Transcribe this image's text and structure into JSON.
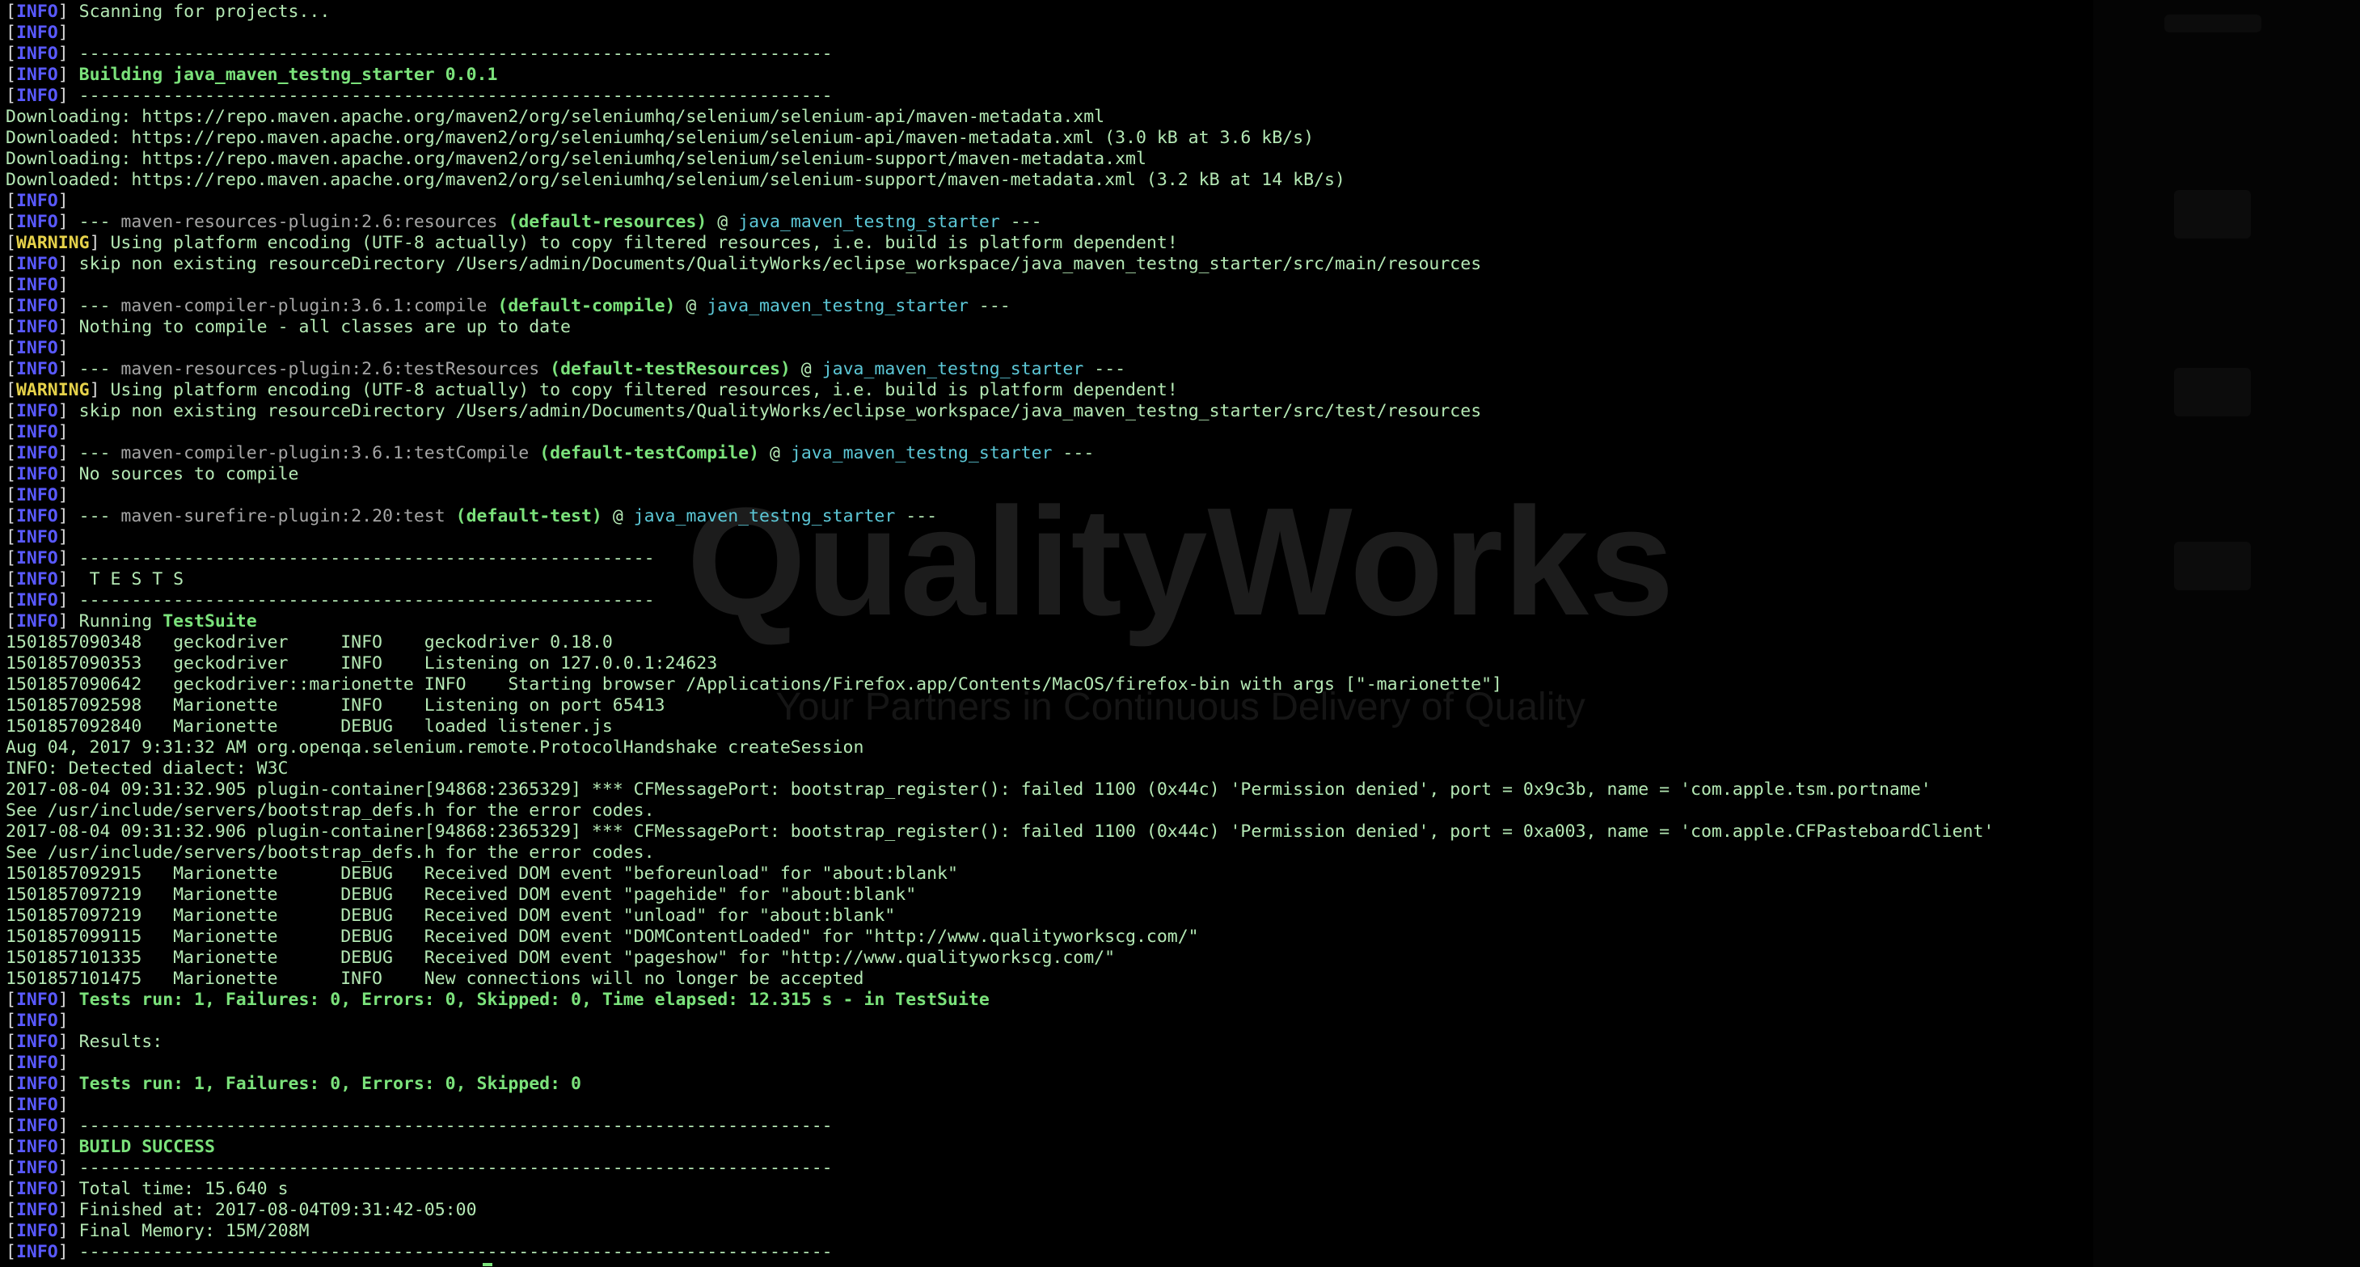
{
  "watermark": {
    "brand": "QualityWorks",
    "tagline": "Your Partners in Continuous Delivery of Quality"
  },
  "colors": {
    "background": "#000000",
    "info_tag": "#5959ff",
    "warning_tag": "#e6d24a",
    "highlight": "#7be27b",
    "plugin": "#a5a5a5",
    "project": "#5cc7d6",
    "text": "#d9d9d9"
  },
  "lines": [
    {
      "tag": "INFO",
      "segs": [
        {
          "t": " Scanning for projects...",
          "s": "green"
        }
      ]
    },
    {
      "tag": "INFO",
      "segs": []
    },
    {
      "tag": "INFO",
      "segs": [
        {
          "t": " ------------------------------------------------------------------------",
          "s": "green"
        }
      ]
    },
    {
      "tag": "INFO",
      "segs": [
        {
          "t": " ",
          "s": "green"
        },
        {
          "t": "Building java_maven_testng_starter 0.0.1",
          "s": "boldgreen"
        }
      ]
    },
    {
      "tag": "INFO",
      "segs": [
        {
          "t": " ------------------------------------------------------------------------",
          "s": "green"
        }
      ]
    },
    {
      "tag": "",
      "segs": [
        {
          "t": "Downloading: https://repo.maven.apache.org/maven2/org/seleniumhq/selenium/selenium-api/maven-metadata.xml",
          "s": "green"
        }
      ]
    },
    {
      "tag": "",
      "segs": [
        {
          "t": "Downloaded: https://repo.maven.apache.org/maven2/org/seleniumhq/selenium/selenium-api/maven-metadata.xml (3.0 kB at 3.6 kB/s)",
          "s": "green"
        }
      ]
    },
    {
      "tag": "",
      "segs": [
        {
          "t": "Downloading: https://repo.maven.apache.org/maven2/org/seleniumhq/selenium/selenium-support/maven-metadata.xml",
          "s": "green"
        }
      ]
    },
    {
      "tag": "",
      "segs": [
        {
          "t": "Downloaded: https://repo.maven.apache.org/maven2/org/seleniumhq/selenium/selenium-support/maven-metadata.xml (3.2 kB at 14 kB/s)",
          "s": "green"
        }
      ]
    },
    {
      "tag": "INFO",
      "segs": []
    },
    {
      "tag": "INFO",
      "segs": [
        {
          "t": " --- ",
          "s": "green"
        },
        {
          "t": "maven-resources-plugin:2.6:resources",
          "s": "gray"
        },
        {
          "t": " ",
          "s": "green"
        },
        {
          "t": "(default-resources)",
          "s": "boldgreen"
        },
        {
          "t": " @ ",
          "s": "green"
        },
        {
          "t": "java_maven_testng_starter",
          "s": "cyan"
        },
        {
          "t": " ---",
          "s": "green"
        }
      ]
    },
    {
      "tag": "WARNING",
      "segs": [
        {
          "t": " Using platform encoding (UTF-8 actually) to copy filtered resources, i.e. build is platform dependent!",
          "s": "green"
        }
      ]
    },
    {
      "tag": "INFO",
      "segs": [
        {
          "t": " skip non existing resourceDirectory /Users/admin/Documents/QualityWorks/eclipse_workspace/java_maven_testng_starter/src/main/resources",
          "s": "green"
        }
      ]
    },
    {
      "tag": "INFO",
      "segs": []
    },
    {
      "tag": "INFO",
      "segs": [
        {
          "t": " --- ",
          "s": "green"
        },
        {
          "t": "maven-compiler-plugin:3.6.1:compile",
          "s": "gray"
        },
        {
          "t": " ",
          "s": "green"
        },
        {
          "t": "(default-compile)",
          "s": "boldgreen"
        },
        {
          "t": " @ ",
          "s": "green"
        },
        {
          "t": "java_maven_testng_starter",
          "s": "cyan"
        },
        {
          "t": " ---",
          "s": "green"
        }
      ]
    },
    {
      "tag": "INFO",
      "segs": [
        {
          "t": " Nothing to compile - all classes are up to date",
          "s": "green"
        }
      ]
    },
    {
      "tag": "INFO",
      "segs": []
    },
    {
      "tag": "INFO",
      "segs": [
        {
          "t": " --- ",
          "s": "green"
        },
        {
          "t": "maven-resources-plugin:2.6:testResources",
          "s": "gray"
        },
        {
          "t": " ",
          "s": "green"
        },
        {
          "t": "(default-testResources)",
          "s": "boldgreen"
        },
        {
          "t": " @ ",
          "s": "green"
        },
        {
          "t": "java_maven_testng_starter",
          "s": "cyan"
        },
        {
          "t": " ---",
          "s": "green"
        }
      ]
    },
    {
      "tag": "WARNING",
      "segs": [
        {
          "t": " Using platform encoding (UTF-8 actually) to copy filtered resources, i.e. build is platform dependent!",
          "s": "green"
        }
      ]
    },
    {
      "tag": "INFO",
      "segs": [
        {
          "t": " skip non existing resourceDirectory /Users/admin/Documents/QualityWorks/eclipse_workspace/java_maven_testng_starter/src/test/resources",
          "s": "green"
        }
      ]
    },
    {
      "tag": "INFO",
      "segs": []
    },
    {
      "tag": "INFO",
      "segs": [
        {
          "t": " --- ",
          "s": "green"
        },
        {
          "t": "maven-compiler-plugin:3.6.1:testCompile",
          "s": "gray"
        },
        {
          "t": " ",
          "s": "green"
        },
        {
          "t": "(default-testCompile)",
          "s": "boldgreen"
        },
        {
          "t": " @ ",
          "s": "green"
        },
        {
          "t": "java_maven_testng_starter",
          "s": "cyan"
        },
        {
          "t": " ---",
          "s": "green"
        }
      ]
    },
    {
      "tag": "INFO",
      "segs": [
        {
          "t": " No sources to compile",
          "s": "green"
        }
      ]
    },
    {
      "tag": "INFO",
      "segs": []
    },
    {
      "tag": "INFO",
      "segs": [
        {
          "t": " --- ",
          "s": "green"
        },
        {
          "t": "maven-surefire-plugin:2.20:test",
          "s": "gray"
        },
        {
          "t": " ",
          "s": "green"
        },
        {
          "t": "(default-test)",
          "s": "boldgreen"
        },
        {
          "t": " @ ",
          "s": "green"
        },
        {
          "t": "java_maven_testng_starter",
          "s": "cyan"
        },
        {
          "t": " ---",
          "s": "green"
        }
      ]
    },
    {
      "tag": "INFO",
      "segs": []
    },
    {
      "tag": "INFO",
      "segs": [
        {
          "t": " -------------------------------------------------------",
          "s": "green"
        }
      ]
    },
    {
      "tag": "INFO",
      "segs": [
        {
          "t": "  T E S T S",
          "s": "green"
        }
      ]
    },
    {
      "tag": "INFO",
      "segs": [
        {
          "t": " -------------------------------------------------------",
          "s": "green"
        }
      ]
    },
    {
      "tag": "INFO",
      "segs": [
        {
          "t": " Running ",
          "s": "green"
        },
        {
          "t": "TestSuite",
          "s": "boldgreen"
        }
      ]
    },
    {
      "tag": "",
      "segs": [
        {
          "t": "1501857090348   geckodriver     INFO    geckodriver 0.18.0",
          "s": "green"
        }
      ]
    },
    {
      "tag": "",
      "segs": [
        {
          "t": "1501857090353   geckodriver     INFO    Listening on 127.0.0.1:24623",
          "s": "green"
        }
      ]
    },
    {
      "tag": "",
      "segs": [
        {
          "t": "1501857090642   geckodriver::marionette INFO    Starting browser /Applications/Firefox.app/Contents/MacOS/firefox-bin with args [\"-marionette\"]",
          "s": "green"
        }
      ]
    },
    {
      "tag": "",
      "segs": [
        {
          "t": "1501857092598   Marionette      INFO    Listening on port 65413",
          "s": "green"
        }
      ]
    },
    {
      "tag": "",
      "segs": [
        {
          "t": "1501857092840   Marionette      DEBUG   loaded listener.js",
          "s": "green"
        }
      ]
    },
    {
      "tag": "",
      "segs": [
        {
          "t": "Aug 04, 2017 9:31:32 AM org.openqa.selenium.remote.ProtocolHandshake createSession",
          "s": "green"
        }
      ]
    },
    {
      "tag": "",
      "segs": [
        {
          "t": "INFO: Detected dialect: W3C",
          "s": "green"
        }
      ]
    },
    {
      "tag": "",
      "segs": [
        {
          "t": "2017-08-04 09:31:32.905 plugin-container[94868:2365329] *** CFMessagePort: bootstrap_register(): failed 1100 (0x44c) 'Permission denied', port = 0x9c3b, name = 'com.apple.tsm.portname'",
          "s": "green"
        }
      ]
    },
    {
      "tag": "",
      "segs": [
        {
          "t": "See /usr/include/servers/bootstrap_defs.h for the error codes.",
          "s": "green"
        }
      ]
    },
    {
      "tag": "",
      "segs": [
        {
          "t": "2017-08-04 09:31:32.906 plugin-container[94868:2365329] *** CFMessagePort: bootstrap_register(): failed 1100 (0x44c) 'Permission denied', port = 0xa003, name = 'com.apple.CFPasteboardClient'",
          "s": "green"
        }
      ]
    },
    {
      "tag": "",
      "segs": [
        {
          "t": "See /usr/include/servers/bootstrap_defs.h for the error codes.",
          "s": "green"
        }
      ]
    },
    {
      "tag": "",
      "segs": [
        {
          "t": "1501857092915   Marionette      DEBUG   Received DOM event \"beforeunload\" for \"about:blank\"",
          "s": "green"
        }
      ]
    },
    {
      "tag": "",
      "segs": [
        {
          "t": "1501857097219   Marionette      DEBUG   Received DOM event \"pagehide\" for \"about:blank\"",
          "s": "green"
        }
      ]
    },
    {
      "tag": "",
      "segs": [
        {
          "t": "1501857097219   Marionette      DEBUG   Received DOM event \"unload\" for \"about:blank\"",
          "s": "green"
        }
      ]
    },
    {
      "tag": "",
      "segs": [
        {
          "t": "1501857099115   Marionette      DEBUG   Received DOM event \"DOMContentLoaded\" for \"http://www.qualityworkscg.com/\"",
          "s": "green"
        }
      ]
    },
    {
      "tag": "",
      "segs": [
        {
          "t": "1501857101335   Marionette      DEBUG   Received DOM event \"pageshow\" for \"http://www.qualityworkscg.com/\"",
          "s": "green"
        }
      ]
    },
    {
      "tag": "",
      "segs": [
        {
          "t": "1501857101475   Marionette      INFO    New connections will no longer be accepted",
          "s": "green"
        }
      ]
    },
    {
      "tag": "INFO",
      "segs": [
        {
          "t": " ",
          "s": "green"
        },
        {
          "t": "Tests run: 1, Failures: 0, Errors: 0, Skipped: 0, Time elapsed: 12.315 s - in ",
          "s": "boldgreen"
        },
        {
          "t": "TestSuite",
          "s": "boldgreen"
        }
      ]
    },
    {
      "tag": "INFO",
      "segs": []
    },
    {
      "tag": "INFO",
      "segs": [
        {
          "t": " Results:",
          "s": "green"
        }
      ]
    },
    {
      "tag": "INFO",
      "segs": []
    },
    {
      "tag": "INFO",
      "segs": [
        {
          "t": " ",
          "s": "green"
        },
        {
          "t": "Tests run: 1, Failures: 0, Errors: 0, Skipped: 0",
          "s": "boldgreen"
        }
      ]
    },
    {
      "tag": "INFO",
      "segs": []
    },
    {
      "tag": "INFO",
      "segs": [
        {
          "t": " ------------------------------------------------------------------------",
          "s": "green"
        }
      ]
    },
    {
      "tag": "INFO",
      "segs": [
        {
          "t": " ",
          "s": "green"
        },
        {
          "t": "BUILD SUCCESS",
          "s": "boldgreen"
        }
      ]
    },
    {
      "tag": "INFO",
      "segs": [
        {
          "t": " ------------------------------------------------------------------------",
          "s": "green"
        }
      ]
    },
    {
      "tag": "INFO",
      "segs": [
        {
          "t": " Total time: 15.640 s",
          "s": "green"
        }
      ]
    },
    {
      "tag": "INFO",
      "segs": [
        {
          "t": " Finished at: 2017-08-04T09:31:42-05:00",
          "s": "green"
        }
      ]
    },
    {
      "tag": "INFO",
      "segs": [
        {
          "t": " Final Memory: 15M/208M",
          "s": "green"
        }
      ]
    },
    {
      "tag": "INFO",
      "segs": [
        {
          "t": " ------------------------------------------------------------------------",
          "s": "green"
        }
      ]
    }
  ]
}
